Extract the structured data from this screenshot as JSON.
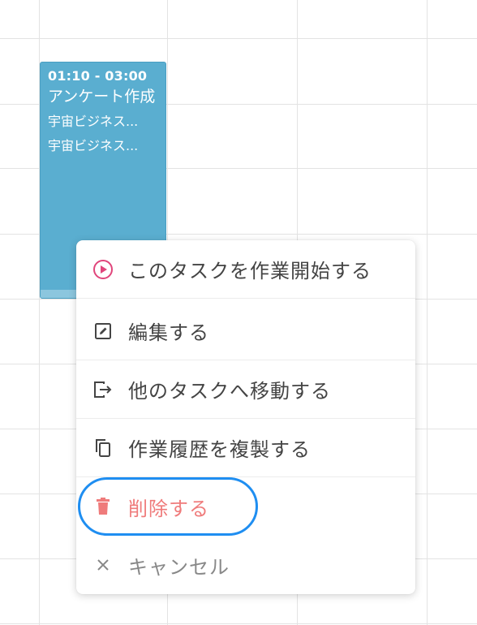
{
  "event": {
    "time": "01:10 - 03:00",
    "title": "アンケート作成",
    "meta1": "宇宙ビジネス...",
    "meta2": "宇宙ビジネス...",
    "color": "#5aaed0"
  },
  "menu": {
    "items": [
      {
        "label": "このタスクを作業開始する",
        "icon": "play-circle-icon"
      },
      {
        "label": "編集する",
        "icon": "edit-icon"
      },
      {
        "label": "他のタスクへ移動する",
        "icon": "move-out-icon"
      },
      {
        "label": "作業履歴を複製する",
        "icon": "copy-icon"
      },
      {
        "label": "削除する",
        "icon": "trash-icon",
        "color": "#ef7b7b"
      },
      {
        "label": "キャンセル",
        "icon": "close-icon"
      }
    ]
  },
  "highlight_color": "#1f8ef1"
}
